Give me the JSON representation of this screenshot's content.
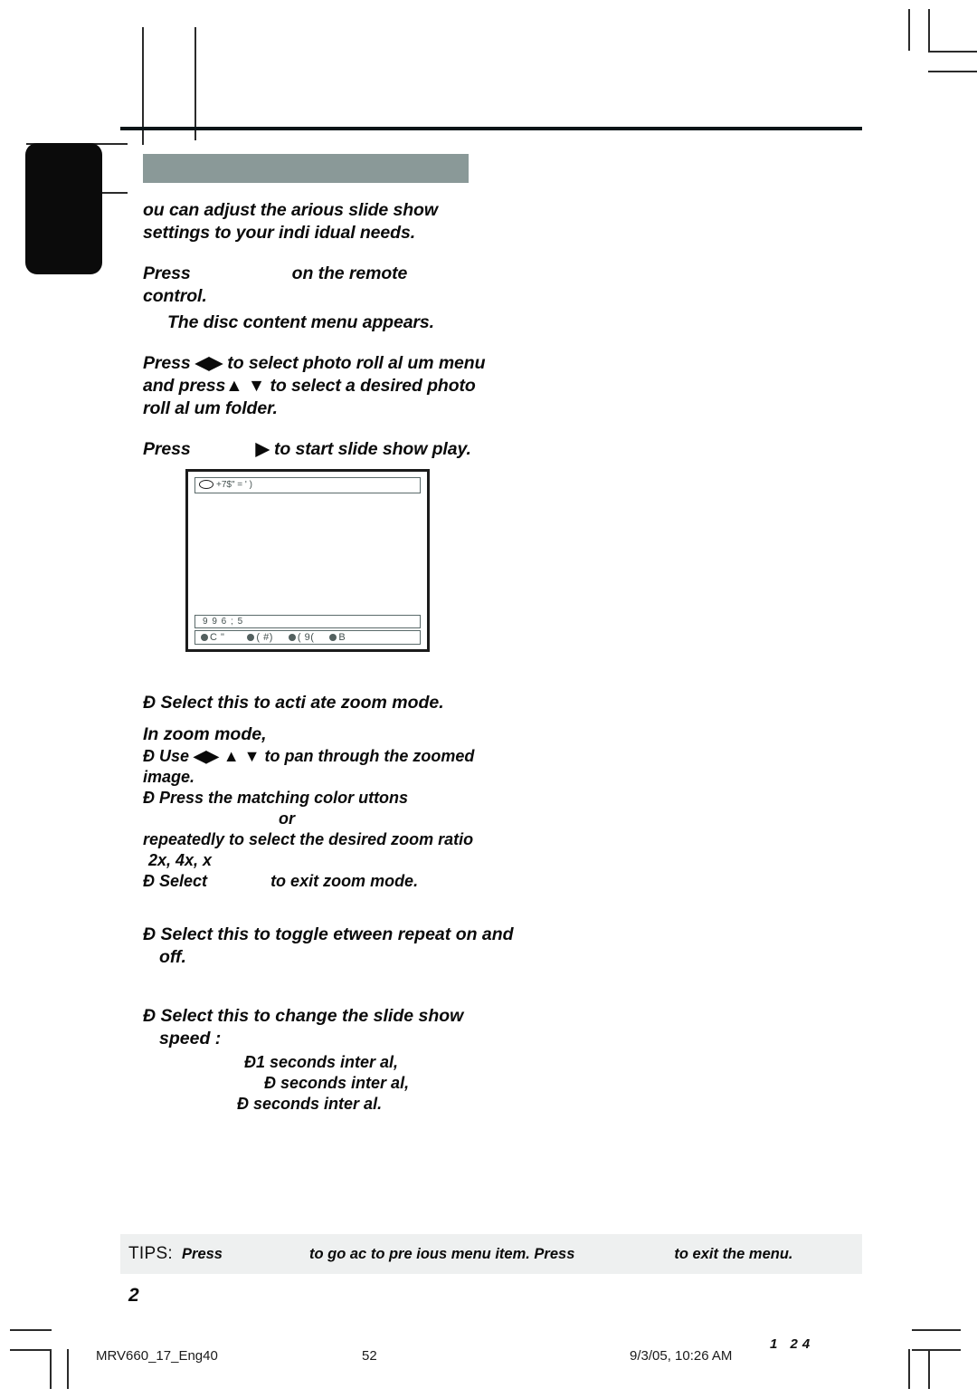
{
  "document": {
    "page_number": "2",
    "top_rule": true
  },
  "section": {
    "band_color": "#8a9998",
    "paragraphs": [
      "ou can adjust the  arious slide show settings to your indi idual needs.",
      "Press",
      "on the remote control.",
      "The disc content menu appears."
    ]
  },
  "steps": {
    "press_label": "Press",
    "on_remote": "on the remote",
    "control": "control.",
    "disc_menu_note": "The disc content menu appears.",
    "select_album_line1_a": "Press",
    "select_album_line1_b": "to select photo roll al  um",
    "select_album_line2_a": "menu and press",
    "select_album_line2_b": "to select a desired",
    "select_album_line3": "photo roll al  um folder.",
    "start_slideshow_a": "Press",
    "start_slideshow_b": "to start slide show play."
  },
  "zoom_section": {
    "activate": "Select this to acti ate zoom mode.",
    "in_zoom_mode": "In zoom mode,",
    "pan_a": "Use",
    "pan_b": "to pan through the zoomed",
    "pan_c": "image.",
    "color_buttons": "Press the matching color   uttons",
    "or": "or",
    "repeatedly": "repeatedly to select the desired zoom ratio",
    "ratios": "2x, 4x,  x",
    "exit_a": "Select",
    "exit_b": "to exit zoom mode."
  },
  "repeat_section": {
    "line1": "Select this to toggle  etween repeat",
    "line2": "on and off."
  },
  "speed_section": {
    "line1": "Select this to change the slide show",
    "line2": "speed :",
    "option1": "1  seconds inter al,",
    "option2": "seconds inter al,",
    "option3": "seconds inter al."
  },
  "tv_figure": {
    "title_bar": "+7$\"   = ' )",
    "status_bar": "9            9 6        ;  5",
    "color_bar": [
      {
        "label": "C  \""
      },
      {
        "label": "( #)"
      },
      {
        "label": "(    9("
      },
      {
        "label": "B"
      }
    ]
  },
  "tips": {
    "label": "TIPS:",
    "press_1": "Press",
    "mid": "to go  ac  to pre ious menu item. Press",
    "end": "to exit the menu."
  },
  "print_footer": {
    "file": "MRV660_17_Eng40",
    "page": "52",
    "date": "9/3/05, 10:26 AM",
    "code": "1  24"
  },
  "bullet_glyph": "Ð"
}
